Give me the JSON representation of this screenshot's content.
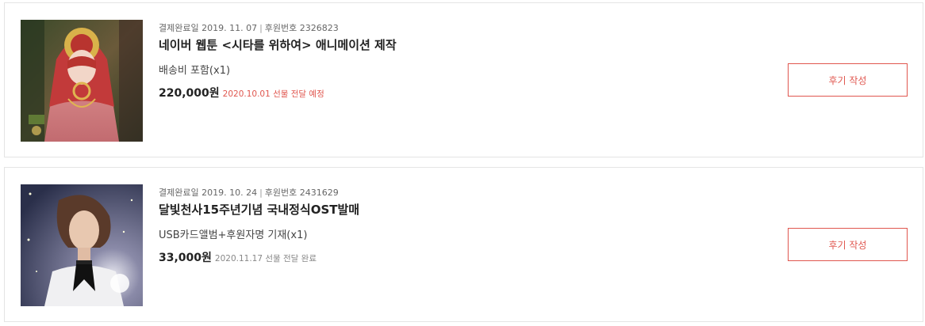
{
  "orders": [
    {
      "payment_date_label": "결제완료일 2019. 11. 07",
      "separator": "|",
      "sponsor_no_label": "후원번호 2326823",
      "title": "네이버 웹툰 <시타를 위하여> 애니메이션 제작",
      "option": "배송비 포함(x1)",
      "price": "220,000원",
      "delivery": "2020.10.01 선물 전달 예정",
      "delivery_color": "#e0574f",
      "review_label": "후기 작성",
      "thumbnail_icon": "webtoon-bride-illustration"
    },
    {
      "payment_date_label": "결제완료일 2019. 10. 24",
      "separator": "|",
      "sponsor_no_label": "후원번호 2431629",
      "title": "달빛천사15주년기념 국내정식OST발매",
      "option": "USB카드앨범+후원자명 기재(x1)",
      "price": "33,000원",
      "delivery": "2020.11.17 선물 전달 완료",
      "delivery_color": "#888888",
      "review_label": "후기 작성",
      "thumbnail_icon": "singer-portrait-photo"
    }
  ],
  "accent_color": "#e0574f"
}
